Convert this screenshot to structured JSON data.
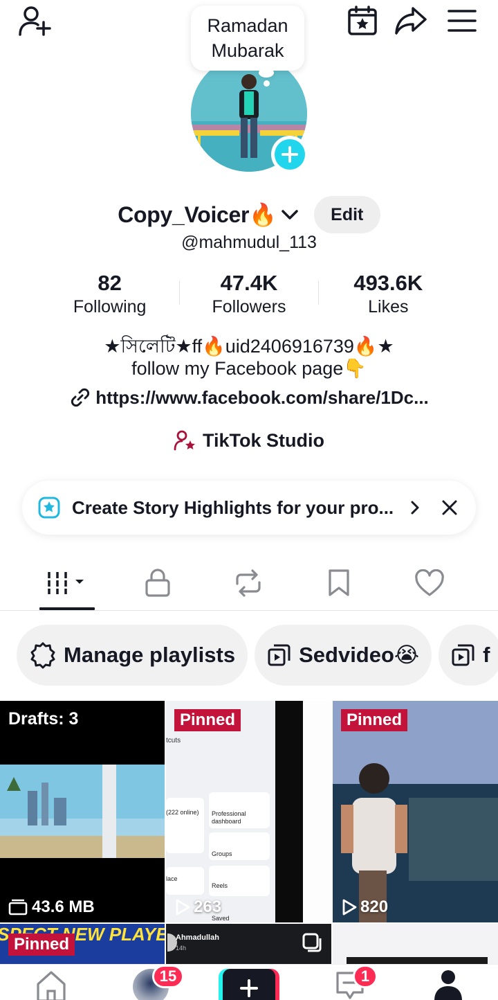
{
  "header": {
    "add_friend_icon": "person-plus-icon",
    "calendar_icon": "calendar-star-icon",
    "share_icon": "share-arrow-icon",
    "menu_icon": "hamburger-menu-icon"
  },
  "bubble": {
    "line1": "Ramadan",
    "line2": "Mubarak"
  },
  "profile": {
    "display_name": "Copy_Voicer🔥",
    "handle": "@mahmudul_113",
    "edit_label": "Edit",
    "stats": [
      {
        "value": "82",
        "label": "Following"
      },
      {
        "value": "47.4K",
        "label": "Followers"
      },
      {
        "value": "493.6K",
        "label": "Likes"
      }
    ],
    "bio_line1": "★সিলেটি★ff🔥uid2406916739🔥★",
    "bio_line2": "follow my Facebook page👇",
    "link": "https://www.facebook.com/share/1Dc...",
    "studio_label": "TikTok Studio"
  },
  "story_banner": {
    "text": "Create Story Highlights for your pro..."
  },
  "tabs": [
    "videos",
    "private",
    "reposts",
    "favorites",
    "liked"
  ],
  "chips": [
    {
      "label": "Manage playlists",
      "icon": "gear-icon"
    },
    {
      "label": "Sedvideo😭",
      "icon": "playlist-icon"
    },
    {
      "label": "f",
      "icon": "playlist-icon"
    }
  ],
  "grid": {
    "drafts_label": "Drafts: 3",
    "drafts_size": "43.6 MB",
    "pinned_label": "Pinned",
    "video2_views": "263",
    "video3_views": "820",
    "row2_caption": "SPECT NEW PLAYERS",
    "row2_user": "Ahmadullah",
    "row2_time": "14h"
  },
  "screenshot_text": {
    "shortcuts": "tcuts",
    "online": "(222 online)",
    "professional": "Professional dashboard",
    "groups": "Groups",
    "place": "lace",
    "reels": "Reels",
    "saved": "Saved"
  },
  "nav": {
    "inbox_badge": "15",
    "messages_badge": "1"
  },
  "colors": {
    "accent": "#fe2c55",
    "teal": "#20d5ec",
    "pinned": "#c4133a"
  }
}
